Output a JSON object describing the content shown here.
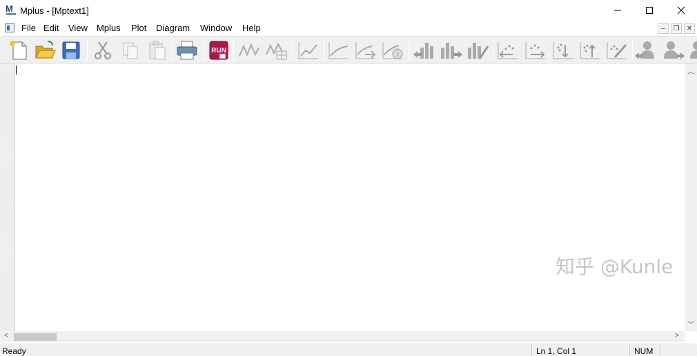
{
  "window": {
    "title": "Mplus - [Mptext1]",
    "app_icon_text": "M",
    "controls": {
      "minimize": "─",
      "maximize": "☐",
      "close": "✕"
    }
  },
  "menu": {
    "items": [
      "File",
      "Edit",
      "View",
      "Mplus",
      "Plot",
      "Diagram",
      "Window",
      "Help"
    ],
    "mdi_controls": {
      "minimize": "–",
      "restore": "❐",
      "close": "✕"
    }
  },
  "toolbar": {
    "run_label": "RUN",
    "buttons": [
      "new-file",
      "open-file",
      "save",
      "cut",
      "copy",
      "paste",
      "print",
      "run",
      "plot-1",
      "plot-2",
      "plot-3",
      "plot-4",
      "plot-5",
      "plot-6",
      "plot-7",
      "plot-8",
      "plot-9",
      "diagram-1",
      "diagram-2",
      "diagram-3",
      "diagram-4",
      "diagram-5",
      "person-1",
      "person-2",
      "person-3"
    ]
  },
  "editor": {
    "content": ""
  },
  "watermark": "知乎 @Kunle",
  "status": {
    "ready": "Ready",
    "position": "Ln 1, Col 1",
    "num": "NUM"
  },
  "colors": {
    "accent": "#1e3e7a",
    "run_bg": "#b0154a",
    "icon_gray": "#9a9a9a"
  }
}
